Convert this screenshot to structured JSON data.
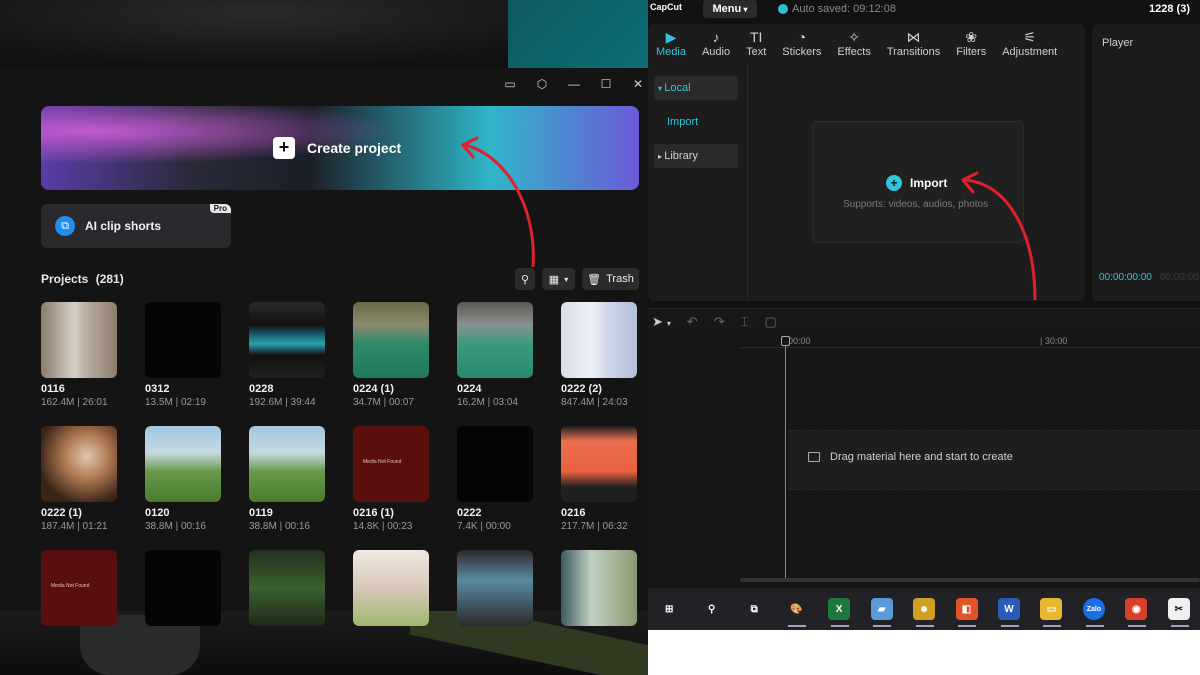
{
  "left": {
    "window_controls": [
      "feedback-icon",
      "settings-icon",
      "minimize-icon",
      "maximize-icon",
      "close-icon"
    ],
    "create_project": {
      "label": "Create project"
    },
    "ai_clip": {
      "label": "AI clip shorts",
      "badge": "Pro"
    },
    "projects_header": {
      "title": "Projects",
      "count": "(281)"
    },
    "trash": {
      "label": "Trash"
    },
    "projects": [
      {
        "name": "0116",
        "meta": "162.4M | 26:01",
        "thumb": "t-twin"
      },
      {
        "name": "0312",
        "meta": "13.5M | 02:19",
        "thumb": "t-black"
      },
      {
        "name": "0228",
        "meta": "192.6M | 39:44",
        "thumb": "t-shirt"
      },
      {
        "name": "0224 (1)",
        "meta": "34.7M | 00:07",
        "thumb": "t-court"
      },
      {
        "name": "0224",
        "meta": "16.2M | 03:04",
        "thumb": "t-court2"
      },
      {
        "name": "0222 (2)",
        "meta": "847.4M | 24:03",
        "thumb": "t-run"
      },
      {
        "name": "0222 (1)",
        "meta": "187.4M | 01:21",
        "thumb": "t-hand"
      },
      {
        "name": "0120",
        "meta": "38.8M | 00:16",
        "thumb": "t-field"
      },
      {
        "name": "0119",
        "meta": "38.8M | 00:16",
        "thumb": "t-field"
      },
      {
        "name": "0216 (1)",
        "meta": "14.8K | 00:23",
        "thumb": "t-red"
      },
      {
        "name": "0222",
        "meta": "7.4K | 00:00",
        "thumb": "t-black"
      },
      {
        "name": "0216",
        "meta": "217.7M | 06:32",
        "thumb": "t-editor"
      },
      {
        "name": "",
        "meta": "",
        "thumb": "t-red"
      },
      {
        "name": "",
        "meta": "",
        "thumb": "t-black"
      },
      {
        "name": "",
        "meta": "",
        "thumb": "t-tree"
      },
      {
        "name": "",
        "meta": "",
        "thumb": "t-girl"
      },
      {
        "name": "",
        "meta": "",
        "thumb": "t-cc"
      },
      {
        "name": "",
        "meta": "",
        "thumb": "t-man"
      }
    ],
    "media_not_found": "Media Not Found"
  },
  "right": {
    "brand": "CapCut",
    "menu_label": "Menu",
    "autosave": "Auto saved: 09:12:08",
    "project_id": "1228 (3)",
    "tabs": [
      {
        "label": "Media",
        "icon": "media-icon",
        "glyph": "▶"
      },
      {
        "label": "Audio",
        "icon": "audio-icon",
        "glyph": "♪"
      },
      {
        "label": "Text",
        "icon": "text-icon",
        "glyph": "TI"
      },
      {
        "label": "Stickers",
        "icon": "stickers-icon",
        "glyph": "◔"
      },
      {
        "label": "Effects",
        "icon": "effects-icon",
        "glyph": "✧"
      },
      {
        "label": "Transitions",
        "icon": "transitions-icon",
        "glyph": "⋈"
      },
      {
        "label": "Filters",
        "icon": "filters-icon",
        "glyph": "❀"
      },
      {
        "label": "Adjustment",
        "icon": "adjustment-icon",
        "glyph": "⚟"
      }
    ],
    "sidenav": {
      "local": "Local",
      "import": "Import",
      "library": "Library"
    },
    "import_box": {
      "label": "Import",
      "sub": "Supports: videos, audios, photos"
    },
    "player": {
      "title": "Player",
      "timecode": "00:00:00:00",
      "timecode2": "00:00:00"
    },
    "ruler": [
      "00:00",
      "| 30:00"
    ],
    "drop_text": "Drag material here and start to create",
    "taskbar": [
      {
        "name": "windows-start-icon",
        "glyph": "⊞",
        "bg": "#222226"
      },
      {
        "name": "search-icon",
        "glyph": "⚲",
        "bg": "#222226"
      },
      {
        "name": "task-view-icon",
        "glyph": "⧉",
        "bg": "#222226"
      },
      {
        "name": "paint-icon",
        "glyph": "🎨",
        "bg": "#222226"
      },
      {
        "name": "excel-icon",
        "glyph": "X",
        "bg": "#1d7a3c"
      },
      {
        "name": "notes-icon",
        "glyph": "▰",
        "bg": "#5a9ad8"
      },
      {
        "name": "chrome-dino-icon",
        "glyph": "☻",
        "bg": "#d0a020"
      },
      {
        "name": "office-icon",
        "glyph": "◧",
        "bg": "#e0542a"
      },
      {
        "name": "word-icon",
        "glyph": "W",
        "bg": "#2b5ab8"
      },
      {
        "name": "explorer-icon",
        "glyph": "▭",
        "bg": "#e8b830"
      },
      {
        "name": "zalo-icon",
        "glyph": "Zalo",
        "bg": "#1a6ee8"
      },
      {
        "name": "chrome-icon",
        "glyph": "◉",
        "bg": "#d8402a"
      },
      {
        "name": "capcut-icon",
        "glyph": "✂",
        "bg": "#f0f0f0"
      }
    ]
  }
}
